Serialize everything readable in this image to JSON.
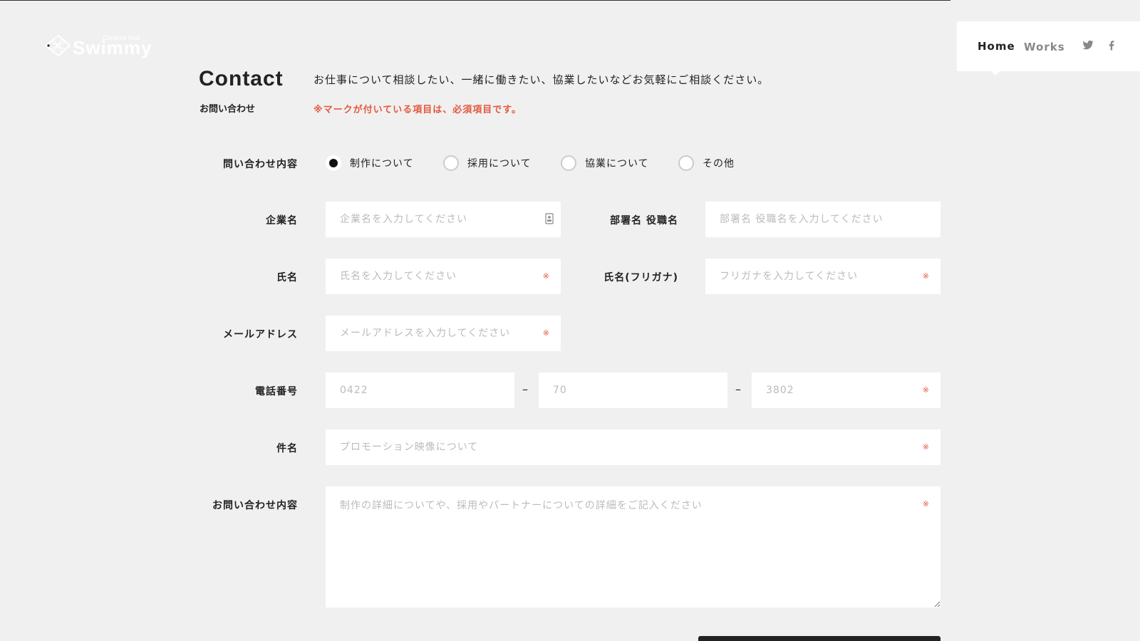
{
  "header": {
    "logo_text": "Swimmy",
    "logo_sub": "Creative Hub",
    "nav": {
      "home": "Home",
      "works": "Works"
    },
    "social": [
      "twitter-icon",
      "facebook-icon"
    ]
  },
  "page": {
    "title": "Contact",
    "subtitle": "お問い合わせ",
    "intro": "お仕事について相談したい、一緒に働きたい、協業したいなどお気軽にご相談ください。",
    "required_note": "※マークが付いている項目は、必須項目です。"
  },
  "form": {
    "inquiry_type": {
      "label": "問い合わせ内容",
      "options": [
        {
          "label": "制作について",
          "checked": true
        },
        {
          "label": "採用について",
          "checked": false
        },
        {
          "label": "協業について",
          "checked": false
        },
        {
          "label": "その他",
          "checked": false
        }
      ]
    },
    "company": {
      "label": "企業名",
      "placeholder": "企業名を入力してください"
    },
    "department": {
      "label": "部署名 役職名",
      "placeholder": "部署名 役職名を入力してください"
    },
    "name": {
      "label": "氏名",
      "placeholder": "氏名を入力してください"
    },
    "kana": {
      "label": "氏名(フリガナ)",
      "placeholder": "フリガナを入力してください"
    },
    "email": {
      "label": "メールアドレス",
      "placeholder": "メールアドレスを入力してください"
    },
    "phone": {
      "label": "電話番号",
      "part1_placeholder": "0422",
      "part2_placeholder": "70",
      "part3_placeholder": "3802",
      "separator": "–"
    },
    "subject": {
      "label": "件名",
      "placeholder": "プロモーション映像について"
    },
    "message": {
      "label": "お問い合わせ内容",
      "placeholder": "制作の詳細についてや、採用やパートナーについての詳細をご記入ください"
    },
    "required_mark": "※"
  },
  "colors": {
    "background": "#f0f0f0",
    "accent_red": "#e4583d",
    "text": "#222222"
  }
}
